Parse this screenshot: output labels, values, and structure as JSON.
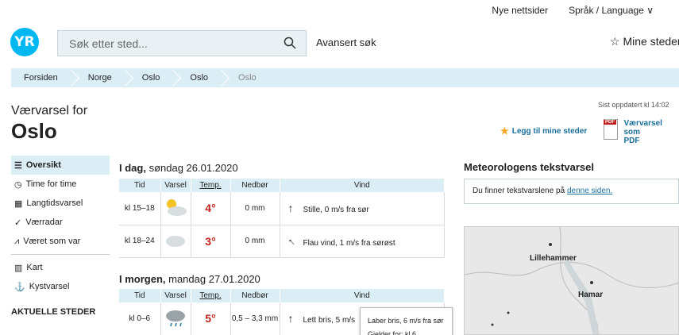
{
  "header": {
    "nye_nettsider": "Nye nettsider",
    "language": "Språk / Language",
    "logo_text": "YR",
    "search_placeholder": "Søk etter sted...",
    "advanced_search": "Avansert søk",
    "mine_steder": "Mine steder"
  },
  "breadcrumb": [
    "Forsiden",
    "Norge",
    "Oslo",
    "Oslo",
    "Oslo"
  ],
  "title": {
    "prefix": "Værvarsel for",
    "city": "Oslo",
    "updated": "Sist oppdatert kl 14:02",
    "legg_til": "Legg til mine steder",
    "pdf_line1": "Værvarsel som",
    "pdf_line2": "PDF"
  },
  "sidebar": {
    "items": [
      {
        "label": "Oversikt",
        "icon": "list-icon"
      },
      {
        "label": "Time for time",
        "icon": "clock-icon"
      },
      {
        "label": "Langtidsvarsel",
        "icon": "calendar-icon"
      },
      {
        "label": "Værradar",
        "icon": "radar-icon"
      },
      {
        "label": "Været som var",
        "icon": "chart-icon"
      },
      {
        "label": "Kart",
        "icon": "map-icon"
      },
      {
        "label": "Kystvarsel",
        "icon": "anchor-icon"
      }
    ],
    "heading": "AKTUELLE STEDER"
  },
  "forecast": {
    "headers": [
      "Tid",
      "Varsel",
      "Temp.",
      "Nedbør",
      "Vind"
    ],
    "today": {
      "label_bold": "I dag,",
      "label_rest": " søndag 26.01.2020",
      "rows": [
        {
          "tid": "kl 15–18",
          "temp": "4°",
          "nedbor": "0 mm",
          "vind": "Stille, 0 m/s fra sør",
          "icon": "partly-sunny-icon"
        },
        {
          "tid": "kl 18–24",
          "temp": "3°",
          "nedbor": "0 mm",
          "vind": "Flau vind, 1 m/s fra sørøst",
          "icon": "cloud-icon"
        }
      ]
    },
    "tomorrow": {
      "label_bold": "I morgen,",
      "label_rest": " mandag 27.01.2020",
      "rows": [
        {
          "tid": "kl 0–6",
          "temp": "5°",
          "nedbor": "0,5 – 3,3 mm",
          "vind": "Lett bris, 5 m/s",
          "icon": "rain-cloud-icon"
        }
      ]
    }
  },
  "tooltip": {
    "line1": "Laber bris, 6 m/s fra sør",
    "line2": "Gjelder for: kl 6"
  },
  "meteorologist": {
    "title": "Meteorologens tekstvarsel",
    "text": "Du finner tekstvarslene på ",
    "link": "denne siden."
  },
  "map": {
    "label1": "Lillehammer",
    "label2": "Hamar"
  },
  "colors": {
    "accent": "#00b8f1",
    "light_blue": "#dbeef6",
    "temp_red": "#c0231d",
    "link": "#1b6f9a"
  }
}
